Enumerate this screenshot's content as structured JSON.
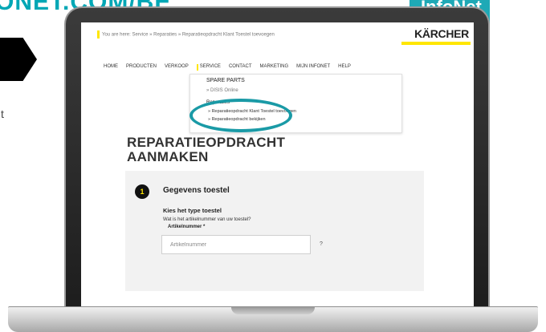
{
  "banner": {
    "heading": "ONET.COM/BE",
    "badge_text": "InfoNet",
    "left_fragment": "t"
  },
  "screen": {
    "breadcrumb": "You are here: Service » Reparaties » Reparatieopdracht Klant Toestel toevoegen",
    "logo_text": "KÄRCHER",
    "nav": {
      "items": [
        "HOME",
        "PRODUCTEN",
        "VERKOOP",
        "SERVICE",
        "CONTACT",
        "MARKETING",
        "MIJN INFONET",
        "HELP"
      ],
      "active": "SERVICE"
    },
    "dropdown": {
      "title": "SPARE PARTS",
      "sub_item": "» DISIS Online",
      "section": "Reparaties",
      "links": [
        "» Reparatieopdracht Klant Toestel toevoegen",
        "» Reparatieopdracht bekijken"
      ]
    },
    "page_title_line1": "REPARATIEOPDRACHT",
    "page_title_line2": "AANMAKEN",
    "form": {
      "step_number": "1",
      "step_title": "Gegevens toestel",
      "question_title": "Kies het type toestel",
      "question_text": "Wat is het artikelnummer van uw toestel?",
      "field_label": "Artikelnummer *",
      "field_placeholder": "Artikelnummer",
      "field_value": "",
      "help_glyph": "?"
    }
  },
  "colors": {
    "teal": "#1a9aa6",
    "karcher_yellow": "#ffe600",
    "dark": "#222222"
  }
}
